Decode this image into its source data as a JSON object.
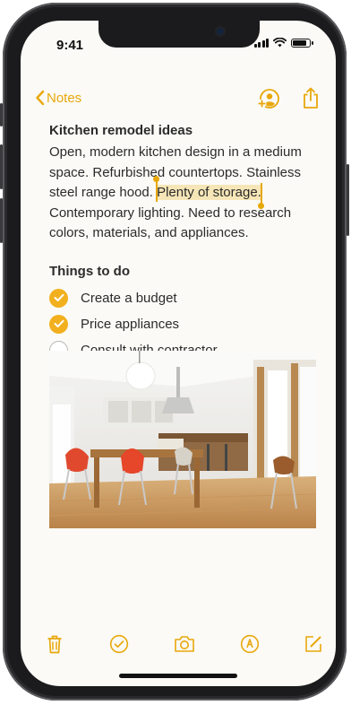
{
  "status": {
    "time": "9:41",
    "battery_level": 0.85
  },
  "nav": {
    "back_label": "Notes"
  },
  "note": {
    "title": "Kitchen remodel ideas",
    "body_before": "Open, modern kitchen design in a medium space. Refurbished countertops. Stainless steel range hood. ",
    "body_selected": "Plenty of storage.",
    "body_after": " Contemporary lighting. Need to research colors, materials, and appliances.",
    "section_title": "Things to do",
    "todos": [
      {
        "label": "Create a budget",
        "done": true
      },
      {
        "label": "Price appliances",
        "done": true
      },
      {
        "label": "Consult with contractor",
        "done": false
      }
    ]
  },
  "colors": {
    "accent": "#e8a80c",
    "check": "#f2b01e",
    "highlight": "#f6e6b7",
    "paper": "#fbfaf6"
  },
  "icons": {
    "nav": [
      "chevron-left-icon",
      "add-person-icon",
      "share-icon"
    ],
    "toolbar": [
      "trash-icon",
      "checklist-icon",
      "camera-icon",
      "markup-icon",
      "compose-icon"
    ]
  }
}
